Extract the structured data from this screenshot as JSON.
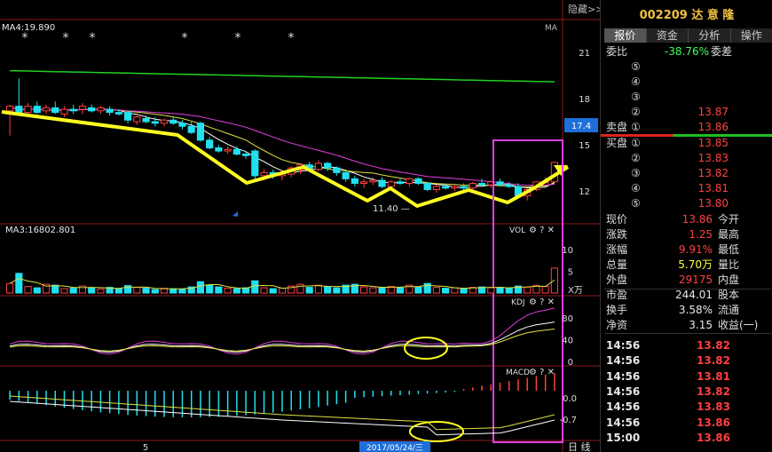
{
  "header": {
    "hide_label": "隐藏",
    "expand_label": ">>"
  },
  "quote": {
    "code_name": "002209 达 意 隆",
    "tabs": [
      "报价",
      "资金",
      "分析",
      "操作"
    ],
    "wei_bi_label": "委比",
    "wei_bi_value": "-38.76%",
    "wei_cha_label": "委差",
    "sell_label": "卖盘",
    "buy_label": "买盘",
    "sell": [
      {
        "level": "⑤",
        "price": "",
        "vol": ""
      },
      {
        "level": "④",
        "price": "",
        "vol": ""
      },
      {
        "level": "③",
        "price": "",
        "vol": ""
      },
      {
        "level": "②",
        "price": "13.87",
        "vol": ""
      },
      {
        "level": "①",
        "price": "13.86",
        "vol": ""
      }
    ],
    "buy": [
      {
        "level": "①",
        "price": "13.85",
        "vol": ""
      },
      {
        "level": "②",
        "price": "13.83",
        "vol": ""
      },
      {
        "level": "③",
        "price": "13.82",
        "vol": ""
      },
      {
        "level": "④",
        "price": "13.81",
        "vol": ""
      },
      {
        "level": "⑤",
        "price": "13.80",
        "vol": ""
      }
    ],
    "stats": [
      {
        "l": "现价",
        "v": "13.86",
        "c": "red",
        "l2": "今开"
      },
      {
        "l": "涨跌",
        "v": "1.25",
        "c": "red",
        "l2": "最高"
      },
      {
        "l": "涨幅",
        "v": "9.91%",
        "c": "red",
        "l2": "最低"
      },
      {
        "l": "总量",
        "v": "5.70万",
        "c": "yellow",
        "l2": "量比"
      },
      {
        "l": "外盘",
        "v": "29175",
        "c": "red",
        "l2": "内盘"
      },
      {
        "l": "市盈",
        "v": "244.01",
        "c": "white",
        "l2": "股本"
      },
      {
        "l": "换手",
        "v": "3.58%",
        "c": "white",
        "l2": "流通"
      },
      {
        "l": "净资",
        "v": "3.15",
        "c": "white",
        "l2": "收益(一)"
      }
    ],
    "ticks": [
      {
        "t": "14:56",
        "p": "13.82"
      },
      {
        "t": "14:56",
        "p": "13.82"
      },
      {
        "t": "14:56",
        "p": "13.81"
      },
      {
        "t": "14:56",
        "p": "13.82"
      },
      {
        "t": "14:56",
        "p": "13.83"
      },
      {
        "t": "14:56",
        "p": "13.86"
      },
      {
        "t": "15:00",
        "p": "13.86"
      }
    ]
  },
  "chart_data": {
    "type": "candlestick",
    "price_panel": {
      "ma_label": "MA4:19.890",
      "ma_tag": "MA",
      "yticks": [
        12,
        15,
        18,
        21
      ],
      "ylim": [
        10,
        23
      ],
      "current_price_tag": "17.4",
      "low_annotation": "11.40",
      "candles": [
        {
          "o": 17.2,
          "h": 17.6,
          "l": 15.6,
          "c": 17.5
        },
        {
          "o": 17.5,
          "h": 19.3,
          "l": 17.1,
          "c": 17.0
        },
        {
          "o": 17.1,
          "h": 17.7,
          "l": 16.9,
          "c": 17.5
        },
        {
          "o": 17.5,
          "h": 17.8,
          "l": 17.0,
          "c": 17.1
        },
        {
          "o": 17.2,
          "h": 17.6,
          "l": 17.0,
          "c": 17.4
        },
        {
          "o": 17.4,
          "h": 17.8,
          "l": 17.0,
          "c": 17.1
        },
        {
          "o": 17.0,
          "h": 17.5,
          "l": 16.8,
          "c": 17.3
        },
        {
          "o": 17.3,
          "h": 17.6,
          "l": 17.0,
          "c": 17.2
        },
        {
          "o": 17.3,
          "h": 17.7,
          "l": 17.0,
          "c": 17.5
        },
        {
          "o": 17.4,
          "h": 17.6,
          "l": 17.1,
          "c": 17.2
        },
        {
          "o": 17.2,
          "h": 17.5,
          "l": 17.0,
          "c": 17.4
        },
        {
          "o": 17.3,
          "h": 17.5,
          "l": 16.9,
          "c": 17.1
        },
        {
          "o": 17.1,
          "h": 17.3,
          "l": 16.9,
          "c": 17.0
        },
        {
          "o": 17.1,
          "h": 17.2,
          "l": 16.4,
          "c": 16.6
        },
        {
          "o": 16.5,
          "h": 16.9,
          "l": 16.3,
          "c": 16.8
        },
        {
          "o": 16.7,
          "h": 16.9,
          "l": 16.4,
          "c": 16.5
        },
        {
          "o": 16.5,
          "h": 16.8,
          "l": 16.2,
          "c": 16.4
        },
        {
          "o": 16.4,
          "h": 16.7,
          "l": 16.2,
          "c": 16.6
        },
        {
          "o": 16.6,
          "h": 16.8,
          "l": 16.3,
          "c": 16.4
        },
        {
          "o": 16.4,
          "h": 16.6,
          "l": 16.0,
          "c": 16.2
        },
        {
          "o": 16.2,
          "h": 16.5,
          "l": 15.7,
          "c": 15.8
        },
        {
          "o": 16.4,
          "h": 16.5,
          "l": 15.2,
          "c": 15.3
        },
        {
          "o": 15.3,
          "h": 15.5,
          "l": 14.7,
          "c": 14.8
        },
        {
          "o": 14.8,
          "h": 15.0,
          "l": 14.5,
          "c": 14.6
        },
        {
          "o": 14.6,
          "h": 14.9,
          "l": 14.4,
          "c": 14.7
        },
        {
          "o": 14.7,
          "h": 14.9,
          "l": 14.3,
          "c": 14.4
        },
        {
          "o": 14.4,
          "h": 14.6,
          "l": 14.1,
          "c": 14.3
        },
        {
          "o": 14.6,
          "h": 14.7,
          "l": 12.8,
          "c": 13.0
        },
        {
          "o": 13.0,
          "h": 13.4,
          "l": 12.7,
          "c": 13.2
        },
        {
          "o": 13.2,
          "h": 13.4,
          "l": 12.8,
          "c": 13.0
        },
        {
          "o": 13.0,
          "h": 13.3,
          "l": 12.7,
          "c": 13.1
        },
        {
          "o": 13.1,
          "h": 13.6,
          "l": 12.9,
          "c": 13.5
        },
        {
          "o": 13.4,
          "h": 13.8,
          "l": 13.1,
          "c": 13.7
        },
        {
          "o": 13.7,
          "h": 13.9,
          "l": 13.3,
          "c": 13.4
        },
        {
          "o": 13.4,
          "h": 14.0,
          "l": 13.3,
          "c": 13.8
        },
        {
          "o": 13.8,
          "h": 13.9,
          "l": 13.3,
          "c": 13.5
        },
        {
          "o": 13.5,
          "h": 13.6,
          "l": 13.0,
          "c": 13.2
        },
        {
          "o": 13.2,
          "h": 13.4,
          "l": 12.6,
          "c": 12.8
        },
        {
          "o": 12.8,
          "h": 13.0,
          "l": 12.3,
          "c": 12.5
        },
        {
          "o": 12.5,
          "h": 12.8,
          "l": 12.2,
          "c": 12.6
        },
        {
          "o": 12.6,
          "h": 12.9,
          "l": 12.4,
          "c": 12.7
        },
        {
          "o": 12.7,
          "h": 12.9,
          "l": 12.2,
          "c": 12.3
        },
        {
          "o": 12.3,
          "h": 12.7,
          "l": 12.2,
          "c": 12.6
        },
        {
          "o": 12.6,
          "h": 12.8,
          "l": 12.4,
          "c": 12.5
        },
        {
          "o": 12.5,
          "h": 12.9,
          "l": 12.3,
          "c": 12.8
        },
        {
          "o": 12.8,
          "h": 12.9,
          "l": 12.4,
          "c": 12.5
        },
        {
          "o": 12.5,
          "h": 12.6,
          "l": 12.0,
          "c": 12.1
        },
        {
          "o": 12.1,
          "h": 12.4,
          "l": 11.9,
          "c": 12.3
        },
        {
          "o": 12.3,
          "h": 12.5,
          "l": 12.1,
          "c": 12.2
        },
        {
          "o": 12.2,
          "h": 12.4,
          "l": 12.0,
          "c": 12.3
        },
        {
          "o": 12.3,
          "h": 12.5,
          "l": 12.1,
          "c": 12.2
        },
        {
          "o": 12.2,
          "h": 12.6,
          "l": 12.1,
          "c": 12.5
        },
        {
          "o": 12.5,
          "h": 12.8,
          "l": 12.3,
          "c": 12.4
        },
        {
          "o": 12.4,
          "h": 12.7,
          "l": 12.2,
          "c": 12.6
        },
        {
          "o": 12.6,
          "h": 12.8,
          "l": 12.3,
          "c": 12.4
        },
        {
          "o": 12.4,
          "h": 12.6,
          "l": 12.2,
          "c": 12.3
        },
        {
          "o": 12.3,
          "h": 12.5,
          "l": 11.6,
          "c": 11.7
        },
        {
          "o": 11.7,
          "h": 12.2,
          "l": 11.4,
          "c": 12.1
        },
        {
          "o": 12.1,
          "h": 12.6,
          "l": 12.0,
          "c": 12.6
        },
        {
          "o": 12.6,
          "h": 12.9,
          "l": 12.5,
          "c": 12.6
        },
        {
          "o": 12.6,
          "h": 13.9,
          "l": 12.6,
          "c": 13.86
        }
      ]
    },
    "vol_panel": {
      "label": "MA3:16802.801",
      "tag": "VOL",
      "yticks": [
        5,
        10
      ],
      "unit": "X万",
      "ylim": [
        0,
        13
      ],
      "values": [
        2.2,
        4.5,
        1.5,
        1.2,
        2.0,
        1.8,
        1.0,
        1.1,
        1.6,
        1.2,
        0.9,
        1.3,
        1.0,
        1.7,
        1.3,
        1.1,
        0.8,
        1.1,
        1.0,
        0.9,
        1.4,
        2.6,
        1.8,
        1.4,
        1.1,
        1.0,
        1.2,
        2.8,
        1.2,
        1.0,
        1.1,
        1.6,
        2.0,
        1.3,
        1.8,
        1.5,
        1.2,
        1.8,
        2.0,
        1.4,
        1.2,
        1.3,
        1.5,
        1.2,
        1.8,
        1.4,
        2.2,
        1.3,
        1.1,
        1.2,
        1.0,
        1.3,
        1.4,
        1.2,
        1.3,
        1.1,
        1.6,
        1.4,
        1.7,
        1.5,
        5.7
      ]
    },
    "kdj_panel": {
      "tag": "KDJ",
      "yticks": [
        0,
        40,
        80
      ],
      "ylim": [
        -5,
        100
      ]
    },
    "macd_panel": {
      "tag": "MACD",
      "yticks": [
        "0.0",
        "-0.7"
      ]
    },
    "x_axis": {
      "labels": [
        "5"
      ],
      "cursor_date": "2017/05/24/三",
      "period": "日 线"
    }
  }
}
